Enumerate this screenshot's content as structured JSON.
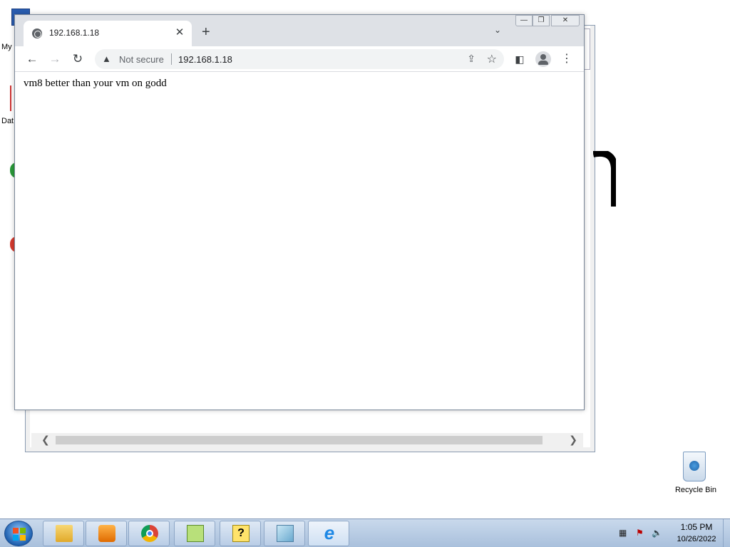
{
  "desktop": {
    "icons": [
      {
        "name": "my-computer-icon",
        "label": "My"
      },
      {
        "name": "data-icon",
        "label": "Dat"
      }
    ],
    "recycle_bin_label": "Recycle Bin"
  },
  "browser": {
    "tab": {
      "title": "192.168.1.18"
    },
    "window_controls": {
      "minimize": "—",
      "maximize": "❐",
      "close": "✕"
    },
    "toolbar": {
      "security_label": "Not secure",
      "url": "192.168.1.18"
    },
    "page": {
      "body_text": "vm8 better than your vm on godd"
    }
  },
  "taskbar": {
    "items": [
      "file-explorer",
      "media-player",
      "chrome",
      "notepad-plus",
      "help",
      "app-window",
      "internet-explorer"
    ],
    "active": "internet-explorer",
    "clock": {
      "time": "1:05 PM",
      "date": "10/26/2022"
    }
  }
}
